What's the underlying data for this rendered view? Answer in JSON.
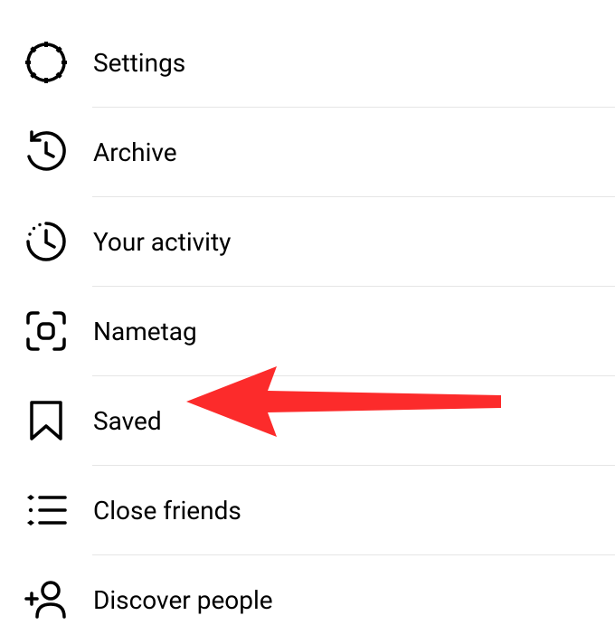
{
  "menu": {
    "items": [
      {
        "label": "Settings"
      },
      {
        "label": "Archive"
      },
      {
        "label": "Your activity"
      },
      {
        "label": "Nametag"
      },
      {
        "label": "Saved"
      },
      {
        "label": "Close friends"
      },
      {
        "label": "Discover people"
      }
    ]
  },
  "annotation": {
    "arrow_color": "#fc2b2b",
    "target_index": 4
  }
}
